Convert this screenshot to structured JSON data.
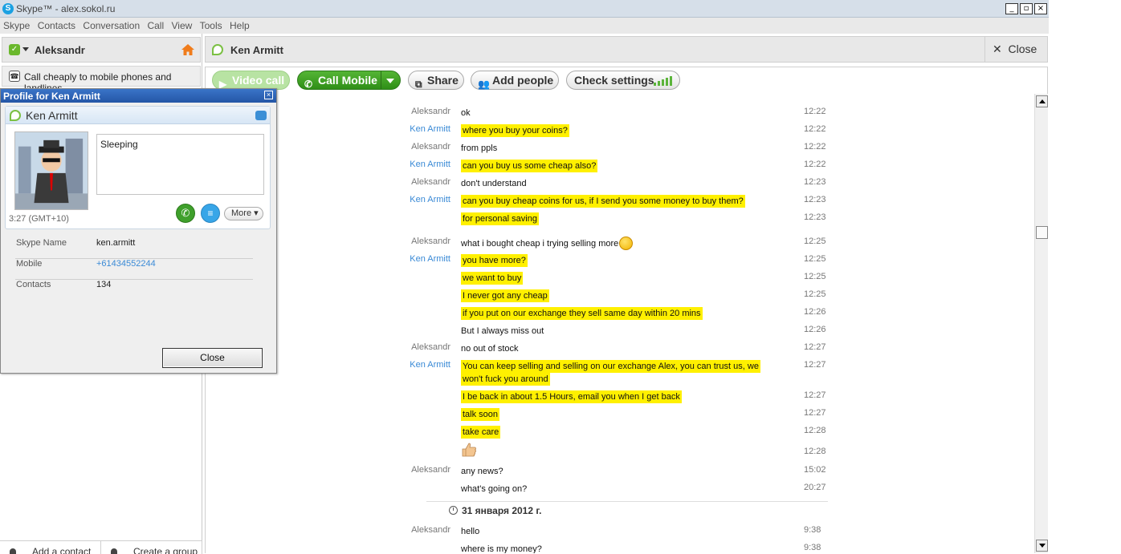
{
  "window": {
    "title": "Skype™ - alex.sokol.ru",
    "controls": [
      "_",
      "▫",
      "×"
    ]
  },
  "menu": [
    "Skype",
    "Contacts",
    "Conversation",
    "Call",
    "View",
    "Tools",
    "Help"
  ],
  "sidebar": {
    "user_name": "Aleksandr",
    "promo_text": "Call cheaply to mobile phones and landlines",
    "bottom": {
      "add_contact": "Add a contact",
      "create_group": "Create a group"
    }
  },
  "profile": {
    "title": "Profile for Ken Armitt",
    "name": "Ken Armitt",
    "mood": "Sleeping",
    "local_time": "3:27 (GMT+10)",
    "more_label": "More",
    "fields": [
      {
        "label": "Skype Name",
        "value": "ken.armitt"
      },
      {
        "label": "Mobile",
        "value": "+61434552244"
      },
      {
        "label": "Contacts",
        "value": "134"
      }
    ],
    "close_label": "Close"
  },
  "conversation": {
    "contact_name": "Ken Armitt",
    "close_label": "Close",
    "toolbar": {
      "video_call": "Video call",
      "call_mobile": "Call Mobile",
      "share": "Share",
      "add_people": "Add people",
      "check_settings": "Check settings"
    },
    "messages": [
      {
        "from": "Aleksandr",
        "text": "ok",
        "time": "12:22",
        "highlight": false
      },
      {
        "from": "Ken Armitt",
        "text": "where you buy your coins?",
        "time": "12:22",
        "highlight": true
      },
      {
        "from": "Aleksandr",
        "text": "from ppls",
        "time": "12:22",
        "highlight": false
      },
      {
        "from": "Ken Armitt",
        "text": "can you buy us some cheap also?",
        "time": "12:22",
        "highlight": true
      },
      {
        "from": "Aleksandr",
        "text": "don't understand",
        "time": "12:23",
        "highlight": false
      },
      {
        "from": "Ken Armitt",
        "text": "can you buy cheap coins for us, if I send you some money to buy them?",
        "time": "12:23",
        "highlight": true
      },
      {
        "from": "",
        "text": "for personal saving",
        "time": "12:23",
        "highlight": true
      },
      {
        "from": "Aleksandr",
        "text": "what i bought cheap i trying selling more",
        "time": "12:25",
        "highlight": false,
        "emoji": "smiley"
      },
      {
        "from": "Ken Armitt",
        "text": "you have more?",
        "time": "12:25",
        "highlight": true
      },
      {
        "from": "",
        "text": "we want to buy",
        "time": "12:25",
        "highlight": true
      },
      {
        "from": "",
        "text": "I never got any cheap",
        "time": "12:25",
        "highlight": true
      },
      {
        "from": "",
        "text": "if you put on our exchange they sell same day within 20 mins",
        "time": "12:26",
        "highlight": true
      },
      {
        "from": "",
        "text": "But I always miss out",
        "time": "12:26",
        "highlight": false
      },
      {
        "from": "Aleksandr",
        "text": "no out of stock",
        "time": "12:27",
        "highlight": false
      },
      {
        "from": "Ken Armitt",
        "text": "You can keep selling and selling on our exchange Alex, you can trust us, we won't fuck you around",
        "time": "12:27",
        "highlight": true
      },
      {
        "from": "",
        "text": "I be back in about 1.5 Hours, email you when I get back",
        "time": "12:27",
        "highlight": true
      },
      {
        "from": "",
        "text": "talk soon",
        "time": "12:27",
        "highlight": true
      },
      {
        "from": "",
        "text": "take care",
        "time": "12:28",
        "highlight": true
      },
      {
        "from": "",
        "text": "",
        "time": "12:28",
        "highlight": false,
        "emoji": "thumbs-up"
      },
      {
        "from": "Aleksandr",
        "text": "any news?",
        "time": "15:02",
        "highlight": false
      },
      {
        "from": "",
        "text": "what's going on?",
        "time": "20:27",
        "highlight": false
      },
      {
        "from": "Aleksandr",
        "text": "hello",
        "time": "9:38",
        "highlight": false
      },
      {
        "from": "",
        "text": "where is my money?",
        "time": "9:38",
        "highlight": false
      }
    ],
    "date_separator": "31 января 2012 г."
  },
  "colors": {
    "highlight": "#fff000",
    "ken_name": "#3a8ad6",
    "call_green": "#3fa02c",
    "title_bar_blue": "#2456a6"
  }
}
